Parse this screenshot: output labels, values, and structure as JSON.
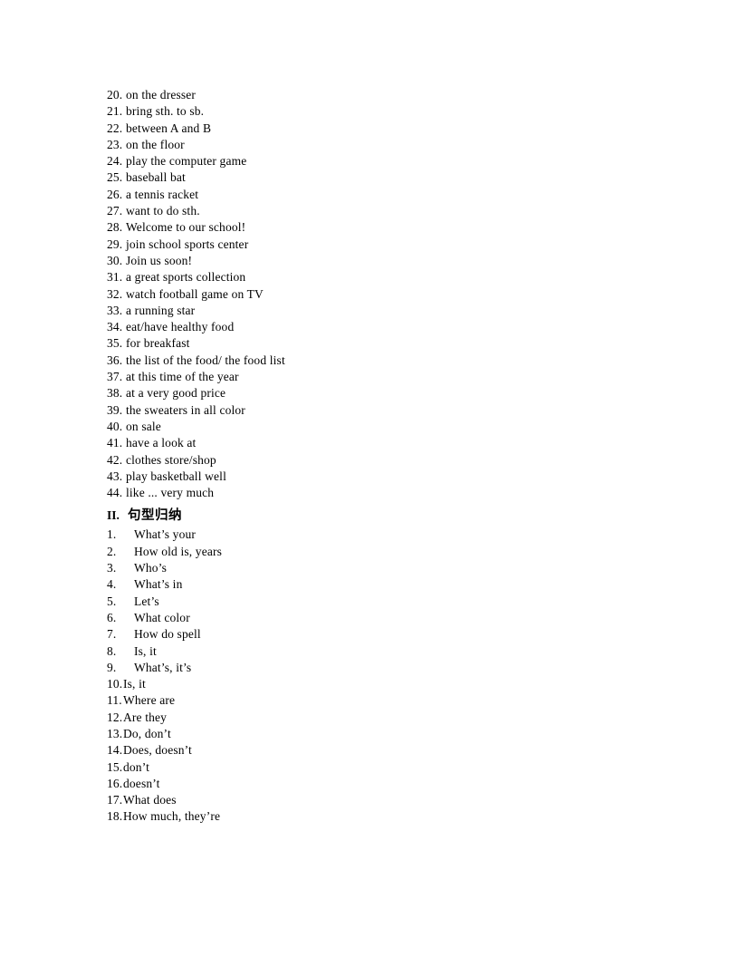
{
  "document": {
    "phrase_section": {
      "items": [
        {
          "num": "20.",
          "text": "on the dresser"
        },
        {
          "num": "21.",
          "text": "bring sth. to sb."
        },
        {
          "num": "22.",
          "text": "between A and B"
        },
        {
          "num": "23.",
          "text": "on the floor"
        },
        {
          "num": "24.",
          "text": "play the computer game"
        },
        {
          "num": "25.",
          "text": "baseball bat"
        },
        {
          "num": "26.",
          "text": "a tennis racket"
        },
        {
          "num": "27.",
          "text": "want to do sth."
        },
        {
          "num": "28.",
          "text": "Welcome to our school!"
        },
        {
          "num": "29.",
          "text": "join school sports center"
        },
        {
          "num": "30.",
          "text": "Join us soon!"
        },
        {
          "num": "31.",
          "text": "a great sports collection"
        },
        {
          "num": "32.",
          "text": "watch football game on TV"
        },
        {
          "num": "33.",
          "text": "a running star"
        },
        {
          "num": "34.",
          "text": "eat/have healthy food"
        },
        {
          "num": "35.",
          "text": "for breakfast"
        },
        {
          "num": "36.",
          "text": "the list of the food/ the food list"
        },
        {
          "num": "37.",
          "text": "at this time of the year"
        },
        {
          "num": "38.",
          "text": "at a very good price"
        },
        {
          "num": "39.",
          "text": "the sweaters in all color"
        },
        {
          "num": "40.",
          "text": "on sale"
        },
        {
          "num": "41.",
          "text": "have a look at"
        },
        {
          "num": "42.",
          "text": "clothes store/shop"
        },
        {
          "num": "43.",
          "text": "play basketball well"
        },
        {
          "num": "44.",
          "text": "like ... very much"
        }
      ]
    },
    "pattern_section": {
      "heading_roman": "II.",
      "heading_title": "句型归纳",
      "items": [
        {
          "num": "1.",
          "text": "What’s your"
        },
        {
          "num": "2.",
          "text": "How old is, years"
        },
        {
          "num": "3.",
          "text": "Who’s"
        },
        {
          "num": "4.",
          "text": "What’s in"
        },
        {
          "num": "5.",
          "text": "Let’s"
        },
        {
          "num": "6.",
          "text": "What color"
        },
        {
          "num": "7.",
          "text": "How do spell"
        },
        {
          "num": "8.",
          "text": "Is, it"
        },
        {
          "num": "9.",
          "text": "What’s, it’s"
        },
        {
          "num": "10.",
          "text": "Is, it"
        },
        {
          "num": "11.",
          "text": "Where are"
        },
        {
          "num": "12.",
          "text": "Are they"
        },
        {
          "num": "13.",
          "text": "Do, don’t"
        },
        {
          "num": "14.",
          "text": "Does, doesn’t"
        },
        {
          "num": "15.",
          "text": "don’t"
        },
        {
          "num": "16.",
          "text": "doesn’t"
        },
        {
          "num": "17.",
          "text": "What does"
        },
        {
          "num": "18.",
          "text": "How much, they’re"
        }
      ]
    }
  }
}
